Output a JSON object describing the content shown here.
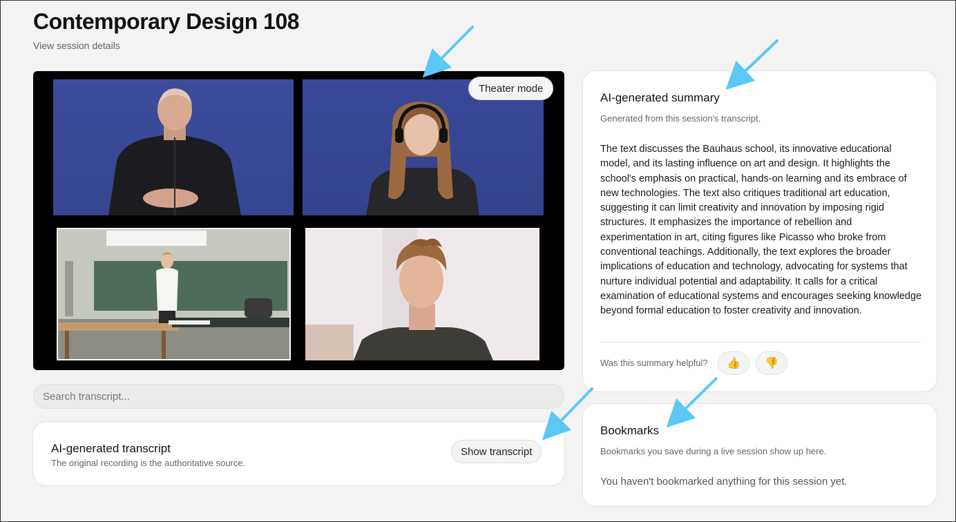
{
  "header": {
    "title": "Contemporary Design 108",
    "subtitle": "View session details"
  },
  "video": {
    "theater_mode_label": "Theater mode",
    "tiles": [
      {
        "name": "video-tile-interpreter-1",
        "subject": "man in dark shirt, blue backdrop"
      },
      {
        "name": "video-tile-interpreter-2",
        "subject": "woman with headset, blue backdrop"
      },
      {
        "name": "video-tile-classroom",
        "subject": "lecturer at chalkboard in classroom"
      },
      {
        "name": "video-tile-student",
        "subject": "young man with curly hair"
      }
    ]
  },
  "search": {
    "placeholder": "Search transcript..."
  },
  "transcript": {
    "title": "AI-generated transcript",
    "subtitle": "The original recording is the authoritative source.",
    "show_label": "Show transcript"
  },
  "summary": {
    "title": "AI-generated summary",
    "subtitle": "Generated from this session's transcript.",
    "body": "The text discusses the Bauhaus school, its innovative educational model, and its lasting influence on art and design. It highlights the school's emphasis on practical, hands-on learning and its embrace of new technologies. The text also critiques traditional art education, suggesting it can limit creativity and innovation by imposing rigid structures. It emphasizes the importance of rebellion and experimentation in art, citing figures like Picasso who broke from conventional teachings. Additionally, the text explores the broader implications of education and technology, advocating for systems that nurture individual potential and adaptability. It calls for a critical examination of educational systems and encourages seeking knowledge beyond formal education to foster creativity and innovation.",
    "helpful_label": "Was this summary helpful?",
    "thumbs_up_icon": "👍",
    "thumbs_down_icon": "👎"
  },
  "bookmarks": {
    "title": "Bookmarks",
    "subtitle": "Bookmarks you save during a live session show up here.",
    "empty_text": "You haven't bookmarked anything for this session yet."
  },
  "colors": {
    "annotation_arrow": "#5bc8f5",
    "page_background": "#f3f3f3",
    "video_backdrop": "#3a4998"
  }
}
